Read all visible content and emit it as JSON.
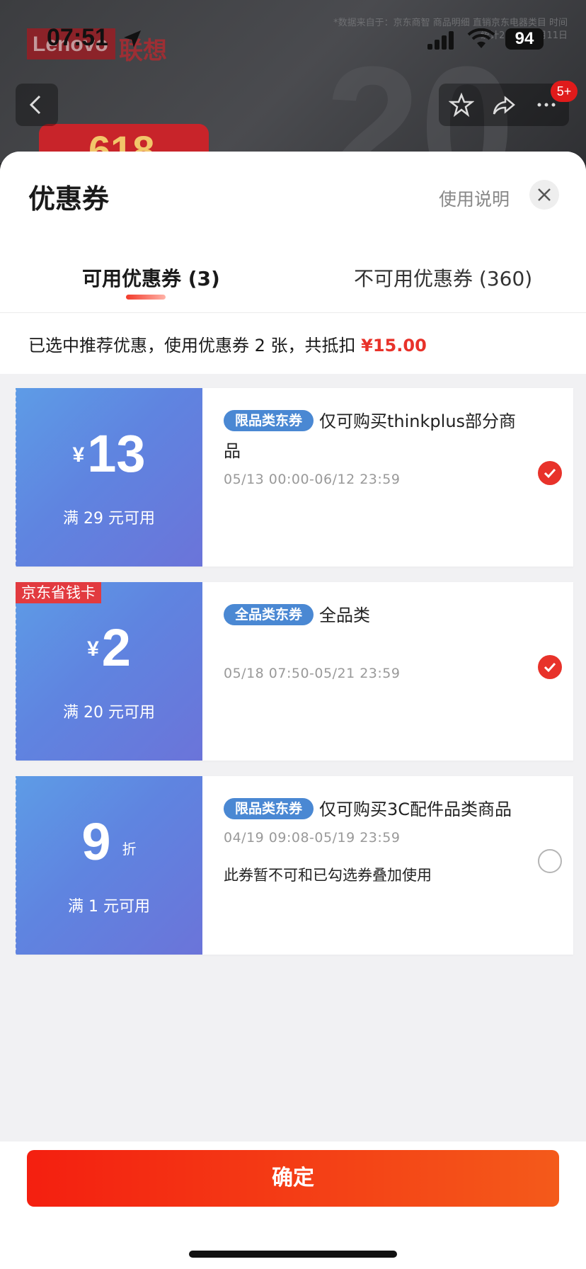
{
  "status_bar": {
    "time": "07:51",
    "battery": "94"
  },
  "backdrop": {
    "brand_en": "Lenovo",
    "brand_cn": "联想",
    "watermark": "*数据来自于：京东商智 商品明细 直销京东电器类目 时间统计2023年5月11日",
    "promo": "618",
    "big_number": "20"
  },
  "header_badge": "5+",
  "sheet": {
    "title": "优惠券",
    "help_link": "使用说明",
    "tabs": [
      {
        "label": "可用优惠券 (3)",
        "active": true
      },
      {
        "label": "不可用优惠券 (360)",
        "active": false
      }
    ],
    "summary": {
      "text": "已选中推荐优惠，使用优惠券 2 张，共抵扣 ",
      "amount": "¥15.00"
    }
  },
  "coupons": [
    {
      "currency": "¥",
      "amount": "13",
      "threshold": "满 29 元可用",
      "tag": "限品类东券",
      "desc": "仅可购买thinkplus部分商品",
      "date": "05/13 00:00-06/12 23:59",
      "checked": true
    },
    {
      "corner_tag": "京东省钱卡",
      "currency": "¥",
      "amount": "2",
      "threshold": "满 20 元可用",
      "tag": "全品类东券",
      "desc": "全品类",
      "date": "05/18 07:50-05/21 23:59",
      "checked": true
    },
    {
      "amount": "9",
      "unit": "折",
      "threshold": "满 1 元可用",
      "tag": "限品类东券",
      "desc": "仅可购买3C配件品类商品",
      "date": "04/19 09:08-05/19 23:59",
      "note": "此券暂不可和已勾选券叠加使用",
      "checked": false
    }
  ],
  "footer": {
    "confirm_label": "确定"
  },
  "colors": {
    "accent_red": "#e8322a",
    "coupon_blue": "#5f84e0",
    "tag_blue": "#4a88d3"
  }
}
